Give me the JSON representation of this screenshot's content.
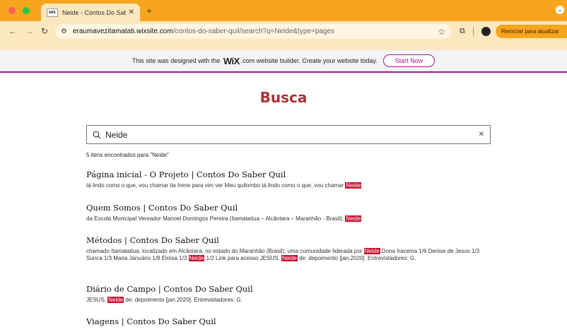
{
  "browser": {
    "tab_title": "Neide - Contos Do Saber Quil",
    "favicon_text": "wix",
    "url_host": "eraumavezitamatati.wixsite.com",
    "url_path": "/contos-do-saber-quil/search?q=Neide&type=pages",
    "update_button": "Reiniciar para atualizar"
  },
  "wix_banner": {
    "text_before": "This site was designed with the",
    "logo": "WiX",
    "text_after": ".com website builder. Create your website today.",
    "cta": "Start Now"
  },
  "page": {
    "title": "Busca",
    "search_value": "Neide",
    "result_count": "5 itens encontrados para \"Neide\""
  },
  "results": [
    {
      "title": "Página inicial - O Projeto | Contos Do Saber Quil",
      "snippet_1": "tá lindo como o que, vou chamar tia Irene para vim ver Meu quilombo tá lindo como o que, vou chamar ",
      "hl_1": "Neide"
    },
    {
      "title": "Quem Somos | Contos Do Saber Quil",
      "snippet_1": "da Escola Municipal Vereador Manoel Domingos Pereira (Itamatatiua – Alcântara – Maranhão - Brasil); ",
      "hl_1": "Neide"
    },
    {
      "title": "Métodos | Contos Do Saber Quil",
      "snippet_1": "chamado Itamatatiua, localizado em Alcântara, no estado do Maranhão (Brasil), uma comunidade liderada por ",
      "hl_1": "Neide",
      "snippet_2": " Dona Iracema 1/6 Denise de Jesus 1/3 Surica 1/3 Maria Januário 1/8 Eloísa 1/3 ",
      "hl_2": "Neide",
      "snippet_3": " 1/2 Link para acesso JESUS, ",
      "hl_3": "Neide",
      "snippet_4": " de: depoimento [jan.2020]. Entrevistadores: G."
    },
    {
      "title": "Diário de Campo | Contos Do Saber Quil",
      "snippet_1": "JESUS, ",
      "hl_1": "Neide",
      "snippet_2": " de: depoimento [jan.2020]. Entrevistadores: G."
    },
    {
      "title": "Viagens | Contos Do Saber Quil"
    }
  ],
  "colors": {
    "chrome_tabbar": "#f6a51d",
    "chrome_toolbar": "#fde7bf",
    "title_red": "#a83232",
    "highlight": "#c8102e",
    "wix_purple": "#a0198a"
  }
}
